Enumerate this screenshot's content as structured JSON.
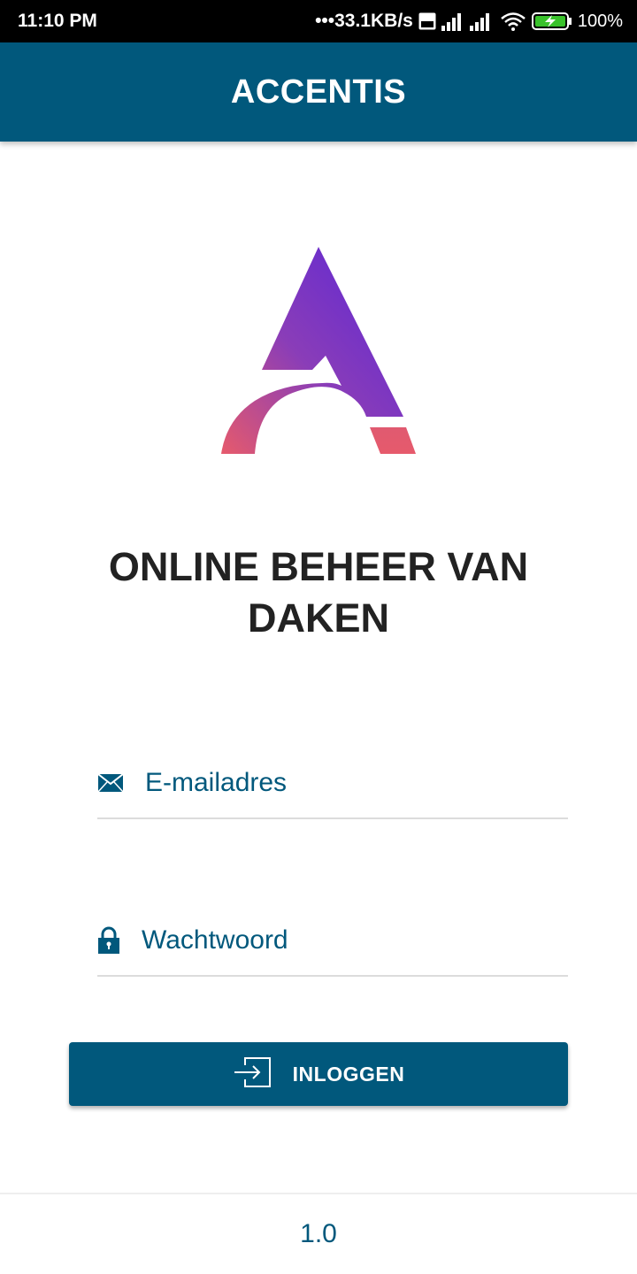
{
  "status_bar": {
    "time": "11:10 PM",
    "network_speed": "•••33.1KB/s",
    "volte_badge": "Vo LTE",
    "battery_percent": "100%",
    "icons": [
      "volte-icon",
      "signal-icon",
      "signal-icon",
      "wifi-icon",
      "battery-charging-icon"
    ]
  },
  "app_bar": {
    "title": "ACCENTIS"
  },
  "logo": {
    "icon": "accentis-logo",
    "colors": {
      "gradient_start": "#5b26d6",
      "gradient_end": "#e65a6c"
    }
  },
  "headline": {
    "line1": "ONLINE BEHEER VAN",
    "line2": "DAKEN"
  },
  "form": {
    "email": {
      "icon": "mail-icon",
      "placeholder": "E-mailadres",
      "value": ""
    },
    "password": {
      "icon": "lock-icon",
      "placeholder": "Wachtwoord",
      "value": ""
    },
    "login_button": {
      "icon": "login-icon",
      "label": "INLOGGEN"
    }
  },
  "footer": {
    "version": "1.0"
  },
  "colors": {
    "primary": "#01587c",
    "status_bar": "#000000",
    "headline_text": "#222222",
    "divider": "#dcdcdc"
  }
}
